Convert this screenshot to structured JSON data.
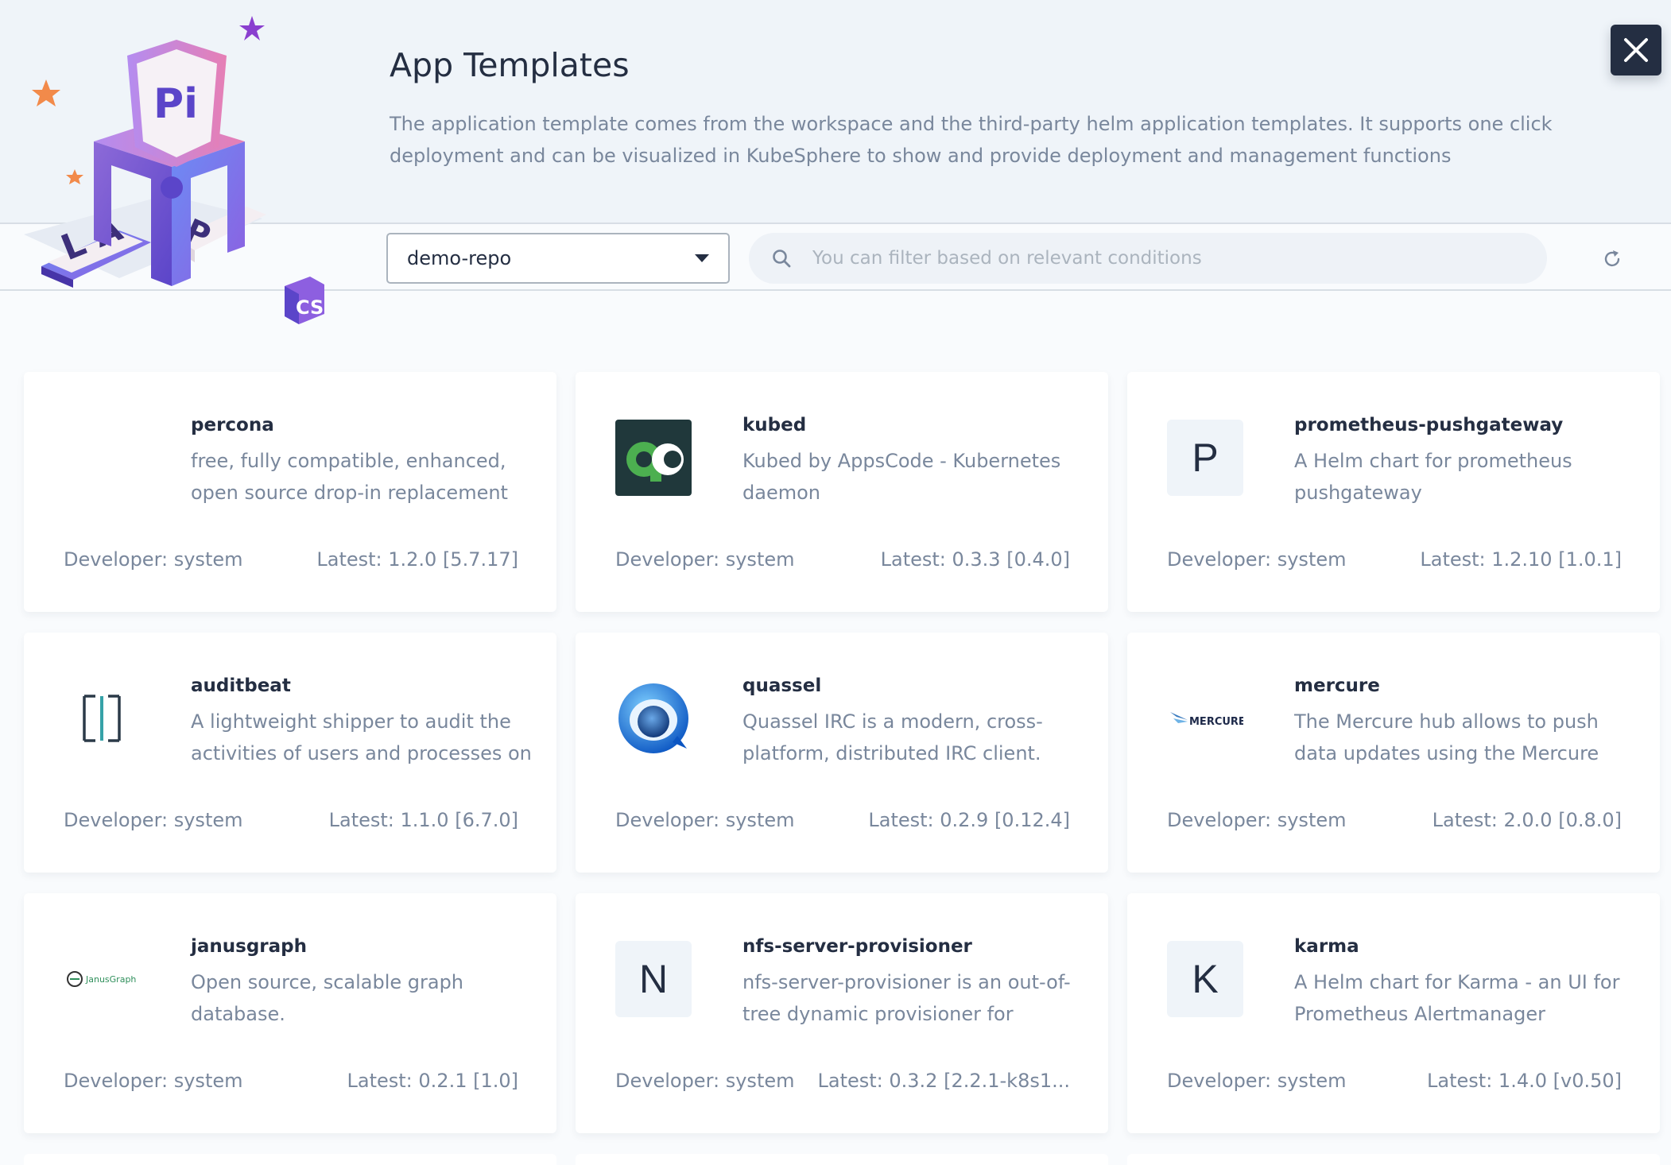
{
  "header": {
    "title": "App Templates",
    "description": "The application template comes from the workspace and the third-party helm application templates. It supports one click deployment and can be visualized in KubeSphere to show and provide deployment and management functions"
  },
  "toolbar": {
    "repo_selected": "demo-repo",
    "search_placeholder": "You can filter based on relevant conditions"
  },
  "colors": {
    "accent": "#242e42",
    "muted_text": "#79879c",
    "header_bg": "#eff4f9"
  },
  "apps": [
    {
      "name": "percona",
      "description": "free, fully compatible, enhanced, open source drop-in replacement",
      "developer": "Developer: system",
      "latest": "Latest: 1.2.0 [5.7.17]",
      "icon": "none"
    },
    {
      "name": "kubed",
      "description": "Kubed by AppsCode - Kubernetes daemon",
      "developer": "Developer: system",
      "latest": "Latest: 0.3.3 [0.4.0]",
      "icon": "kubed-logo-icon"
    },
    {
      "name": "prometheus-pushgateway",
      "description": "A Helm chart for prometheus pushgateway",
      "developer": "Developer: system",
      "latest": "Latest: 1.2.10 [1.0.1]",
      "icon": "letter",
      "letter": "P"
    },
    {
      "name": "auditbeat",
      "description": "A lightweight shipper to audit the activities of users and processes on",
      "developer": "Developer: system",
      "latest": "Latest: 1.1.0 [6.7.0]",
      "icon": "auditbeat-logo-icon"
    },
    {
      "name": "quassel",
      "description": "Quassel IRC is a modern, cross-platform, distributed IRC client.",
      "developer": "Developer: system",
      "latest": "Latest: 0.2.9 [0.12.4]",
      "icon": "quassel-logo-icon"
    },
    {
      "name": "mercure",
      "description": "The Mercure hub allows to push data updates using the Mercure",
      "developer": "Developer: system",
      "latest": "Latest: 2.0.0 [0.8.0]",
      "icon": "mercure-logo-icon",
      "logo_text": "MERCURE"
    },
    {
      "name": "janusgraph",
      "description": "Open source, scalable graph database.",
      "developer": "Developer: system",
      "latest": "Latest: 0.2.1 [1.0]",
      "icon": "janusgraph-logo-icon",
      "logo_text": "JanusGraph"
    },
    {
      "name": "nfs-server-provisioner",
      "description": "nfs-server-provisioner is an out-of-tree dynamic provisioner for",
      "developer": "Developer: system",
      "latest": "Latest: 0.3.2 [2.2.1-k8s1...",
      "icon": "letter",
      "letter": "N"
    },
    {
      "name": "karma",
      "description": "A Helm chart for Karma - an UI for Prometheus Alertmanager",
      "developer": "Developer: system",
      "latest": "Latest: 1.4.0 [v0.50]",
      "icon": "letter",
      "letter": "K"
    }
  ]
}
